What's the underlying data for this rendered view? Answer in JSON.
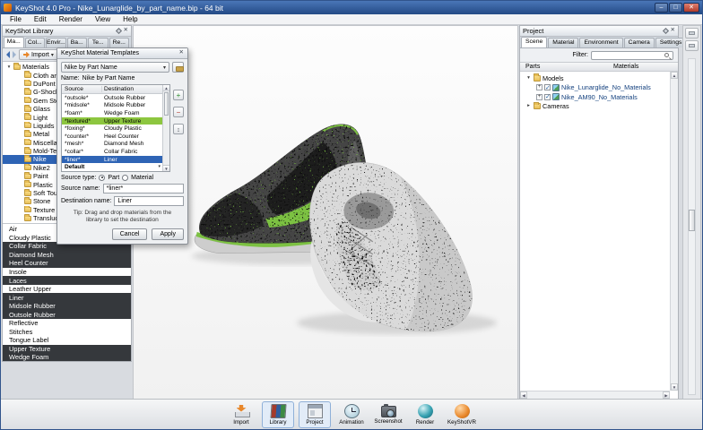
{
  "window": {
    "title": "KeyShot 4.0 Pro - Nike_Lunarglide_by_part_name.bip - 64 bit",
    "menu_items": [
      "File",
      "Edit",
      "Render",
      "View",
      "Help"
    ],
    "controls": {
      "minimize": "–",
      "maximize": "□",
      "close": "✕"
    }
  },
  "library_panel": {
    "title": "KeyShot Library",
    "tabs": [
      {
        "label": "Ma...",
        "selected": true
      },
      {
        "label": "Col...",
        "selected": false
      },
      {
        "label": "Envir...",
        "selected": false
      },
      {
        "label": "Ba...",
        "selected": false
      },
      {
        "label": "Te...",
        "selected": false
      },
      {
        "label": "Re...",
        "selected": false
      }
    ],
    "import_button": "Import",
    "tree": [
      {
        "label": "Materials",
        "depth": 0,
        "exp": "▾",
        "expanded": true
      },
      {
        "label": "Cloth and L...",
        "depth": 1,
        "exp": ""
      },
      {
        "label": "DuPont",
        "depth": 1,
        "exp": ""
      },
      {
        "label": "G-Shock",
        "depth": 1,
        "exp": ""
      },
      {
        "label": "Gem Stone",
        "depth": 1,
        "exp": ""
      },
      {
        "label": "Glass",
        "depth": 1,
        "exp": ""
      },
      {
        "label": "Light",
        "depth": 1,
        "exp": ""
      },
      {
        "label": "Liquids",
        "depth": 1,
        "exp": ""
      },
      {
        "label": "Metal",
        "depth": 1,
        "exp": ""
      },
      {
        "label": "Miscellane...",
        "depth": 1,
        "exp": ""
      },
      {
        "label": "Mold-Tech",
        "depth": 1,
        "exp": ""
      },
      {
        "label": "Nike",
        "depth": 1,
        "exp": "",
        "selected": true
      },
      {
        "label": "Nike2",
        "depth": 1,
        "exp": ""
      },
      {
        "label": "Paint",
        "depth": 1,
        "exp": ""
      },
      {
        "label": "Plastic",
        "depth": 1,
        "exp": ""
      },
      {
        "label": "Soft Touch",
        "depth": 1,
        "exp": ""
      },
      {
        "label": "Stone",
        "depth": 1,
        "exp": ""
      },
      {
        "label": "Texture O...",
        "depth": 1,
        "exp": ""
      },
      {
        "label": "Translucent",
        "depth": 1,
        "exp": ""
      }
    ],
    "materials": [
      {
        "label": "Air",
        "highlighted": false
      },
      {
        "label": "Cloudy Plastic",
        "highlighted": false
      },
      {
        "label": "Collar Fabric",
        "highlighted": true
      },
      {
        "label": "Diamond Mesh",
        "highlighted": true
      },
      {
        "label": "Heel Counter",
        "highlighted": true
      },
      {
        "label": "Insole",
        "highlighted": false
      },
      {
        "label": "Laces",
        "highlighted": true
      },
      {
        "label": "Leather Upper",
        "highlighted": false
      },
      {
        "label": "Liner",
        "highlighted": true
      },
      {
        "label": "Midsole Rubber",
        "highlighted": true
      },
      {
        "label": "Outsole Rubber",
        "highlighted": true
      },
      {
        "label": "Reflective",
        "highlighted": false
      },
      {
        "label": "Stitches",
        "highlighted": false
      },
      {
        "label": "Tongue Label",
        "highlighted": false
      },
      {
        "label": "Upper Texture",
        "highlighted": true
      },
      {
        "label": "Wedge Foam",
        "highlighted": true
      }
    ]
  },
  "dialog": {
    "title": "KeyShot Material Templates",
    "template_name": "Nike by Part Name",
    "name_label": "Name:",
    "name_value": "Nike by Part Name",
    "col_source": "Source",
    "col_destination": "Destination",
    "rows": [
      {
        "source": "*outsole*",
        "destination": "Outsole Rubber"
      },
      {
        "source": "*midsole*",
        "destination": "Midsole Rubber"
      },
      {
        "source": "*foam*",
        "destination": "Wedge Foam"
      },
      {
        "source": "*textured*",
        "destination": "Upper Texture",
        "state": "green"
      },
      {
        "source": "*foxing*",
        "destination": "Cloudy Plastic"
      },
      {
        "source": "*counter*",
        "destination": "Heel Counter"
      },
      {
        "source": "*mesh*",
        "destination": "Diamond Mesh"
      },
      {
        "source": "*collar*",
        "destination": "Collar Fabric"
      },
      {
        "source": "*liner*",
        "destination": "Liner",
        "state": "selected"
      },
      {
        "source": "Default",
        "destination": "",
        "state": "default"
      }
    ],
    "source_type_label": "Source type:",
    "radio_part": "Part",
    "radio_material": "Material",
    "source_name_label": "Source name:",
    "source_name_value": "*liner*",
    "destination_name_label": "Destination name:",
    "destination_name_value": "Liner",
    "tip": "Tip: Drag and drop materials from the library to set the destination",
    "cancel_label": "Cancel",
    "apply_label": "Apply"
  },
  "project_panel": {
    "title": "Project",
    "tabs": [
      {
        "label": "Scene",
        "selected": true
      },
      {
        "label": "Material",
        "selected": false
      },
      {
        "label": "Environment",
        "selected": false
      },
      {
        "label": "Camera",
        "selected": false
      },
      {
        "label": "Settings",
        "selected": false
      }
    ],
    "filter_label": "Filter:",
    "col_parts": "Parts",
    "col_materials": "Materials",
    "tree": [
      {
        "label": "Models",
        "type": "folder",
        "exp": "▾",
        "depth": 0
      },
      {
        "label": "Nike_Lunarglide_No_Materials",
        "type": "model",
        "exp": "+",
        "checked": true,
        "depth": 1
      },
      {
        "label": "Nike_AM90_No_Materials",
        "type": "model",
        "exp": "+",
        "checked": true,
        "depth": 1
      },
      {
        "label": "Cameras",
        "type": "folder",
        "exp": "▸",
        "depth": 0
      }
    ]
  },
  "toolbar": {
    "items": [
      {
        "label": "Import",
        "active": false
      },
      {
        "label": "Library",
        "active": true
      },
      {
        "label": "Project",
        "active": true
      },
      {
        "label": "Animation",
        "active": false
      },
      {
        "label": "Screenshot",
        "active": false
      },
      {
        "label": "Render",
        "active": false
      },
      {
        "label": "KeyShotVR",
        "active": false
      }
    ]
  },
  "colors": {
    "accent_green": "#7cc142",
    "selection_blue": "#2e64b5",
    "highlight_dark": "#35383c",
    "titlebar_blue": "#234a85"
  }
}
